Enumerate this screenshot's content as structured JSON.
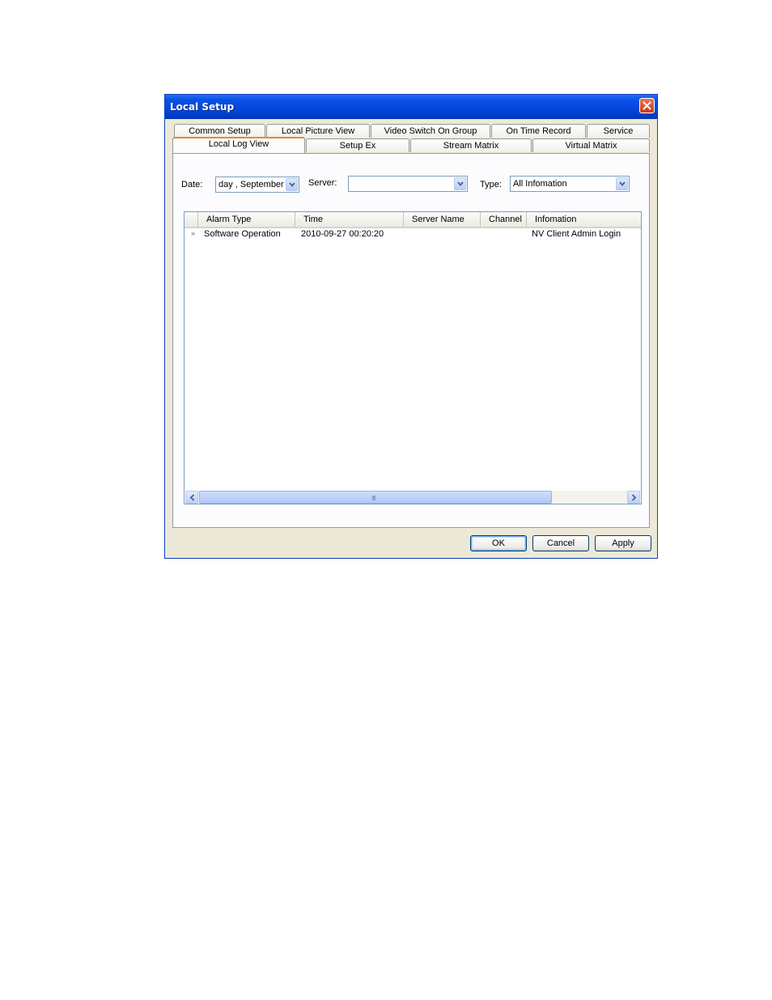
{
  "window": {
    "title": "Local Setup"
  },
  "tabs": {
    "row1": [
      "Common Setup",
      "Local Picture View",
      "Video Switch On Group",
      "On Time Record",
      "Service"
    ],
    "row2": [
      "Local Log View",
      "Setup Ex",
      "Stream Matrix",
      "Virtual Matrix"
    ],
    "active": "Local Log View"
  },
  "filters": {
    "date_label": "Date:",
    "date_value": "day    , September",
    "server_label": "Server:",
    "server_value": "",
    "type_label": "Type:",
    "type_value": "All Infomation"
  },
  "table": {
    "columns": [
      "Alarm Type",
      "Time",
      "Server Name",
      "Channel",
      "Infomation"
    ],
    "rows": [
      {
        "marker": "»",
        "alarm_type": "Software Operation",
        "time": "2010-09-27 00:20:20",
        "server_name": "",
        "channel": "",
        "information": "NV Client Admin Login"
      }
    ]
  },
  "scrollbar": {
    "grip": "IIII"
  },
  "buttons": {
    "ok": "OK",
    "cancel": "Cancel",
    "apply": "Apply"
  }
}
